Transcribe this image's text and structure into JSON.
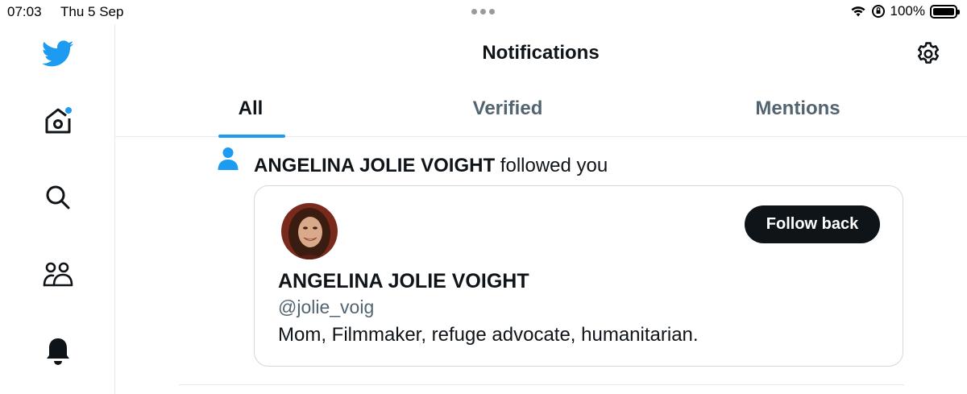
{
  "status_bar": {
    "time": "07:03",
    "date": "Thu 5 Sep",
    "battery_percent": "100%",
    "battery_level": 1.0
  },
  "sidebar": {
    "items": [
      {
        "icon": "twitter-bird-icon",
        "color": "#1d9bf0"
      },
      {
        "icon": "home-icon",
        "has_dot": true,
        "dot_color": "#1d9bf0"
      },
      {
        "icon": "search-icon"
      },
      {
        "icon": "communities-icon"
      },
      {
        "icon": "bell-icon"
      }
    ]
  },
  "header": {
    "title": "Notifications",
    "settings_icon": "gear-icon"
  },
  "tabs": [
    {
      "label": "All",
      "active": true
    },
    {
      "label": "Verified",
      "active": false
    },
    {
      "label": "Mentions",
      "active": false
    }
  ],
  "notification": {
    "icon": "person-icon",
    "actor": "ANGELINA JOLIE VOIGHT",
    "action": " followed you",
    "card": {
      "name": "ANGELINA JOLIE VOIGHT",
      "handle": "@jolie_voig",
      "bio": "Mom, Filmmaker, refuge advocate, humanitarian.",
      "follow_button": "Follow back"
    }
  },
  "colors": {
    "accent": "#1d9bf0",
    "text_primary": "#0f1419",
    "text_secondary": "#536471",
    "border": "#e7e9ea"
  }
}
